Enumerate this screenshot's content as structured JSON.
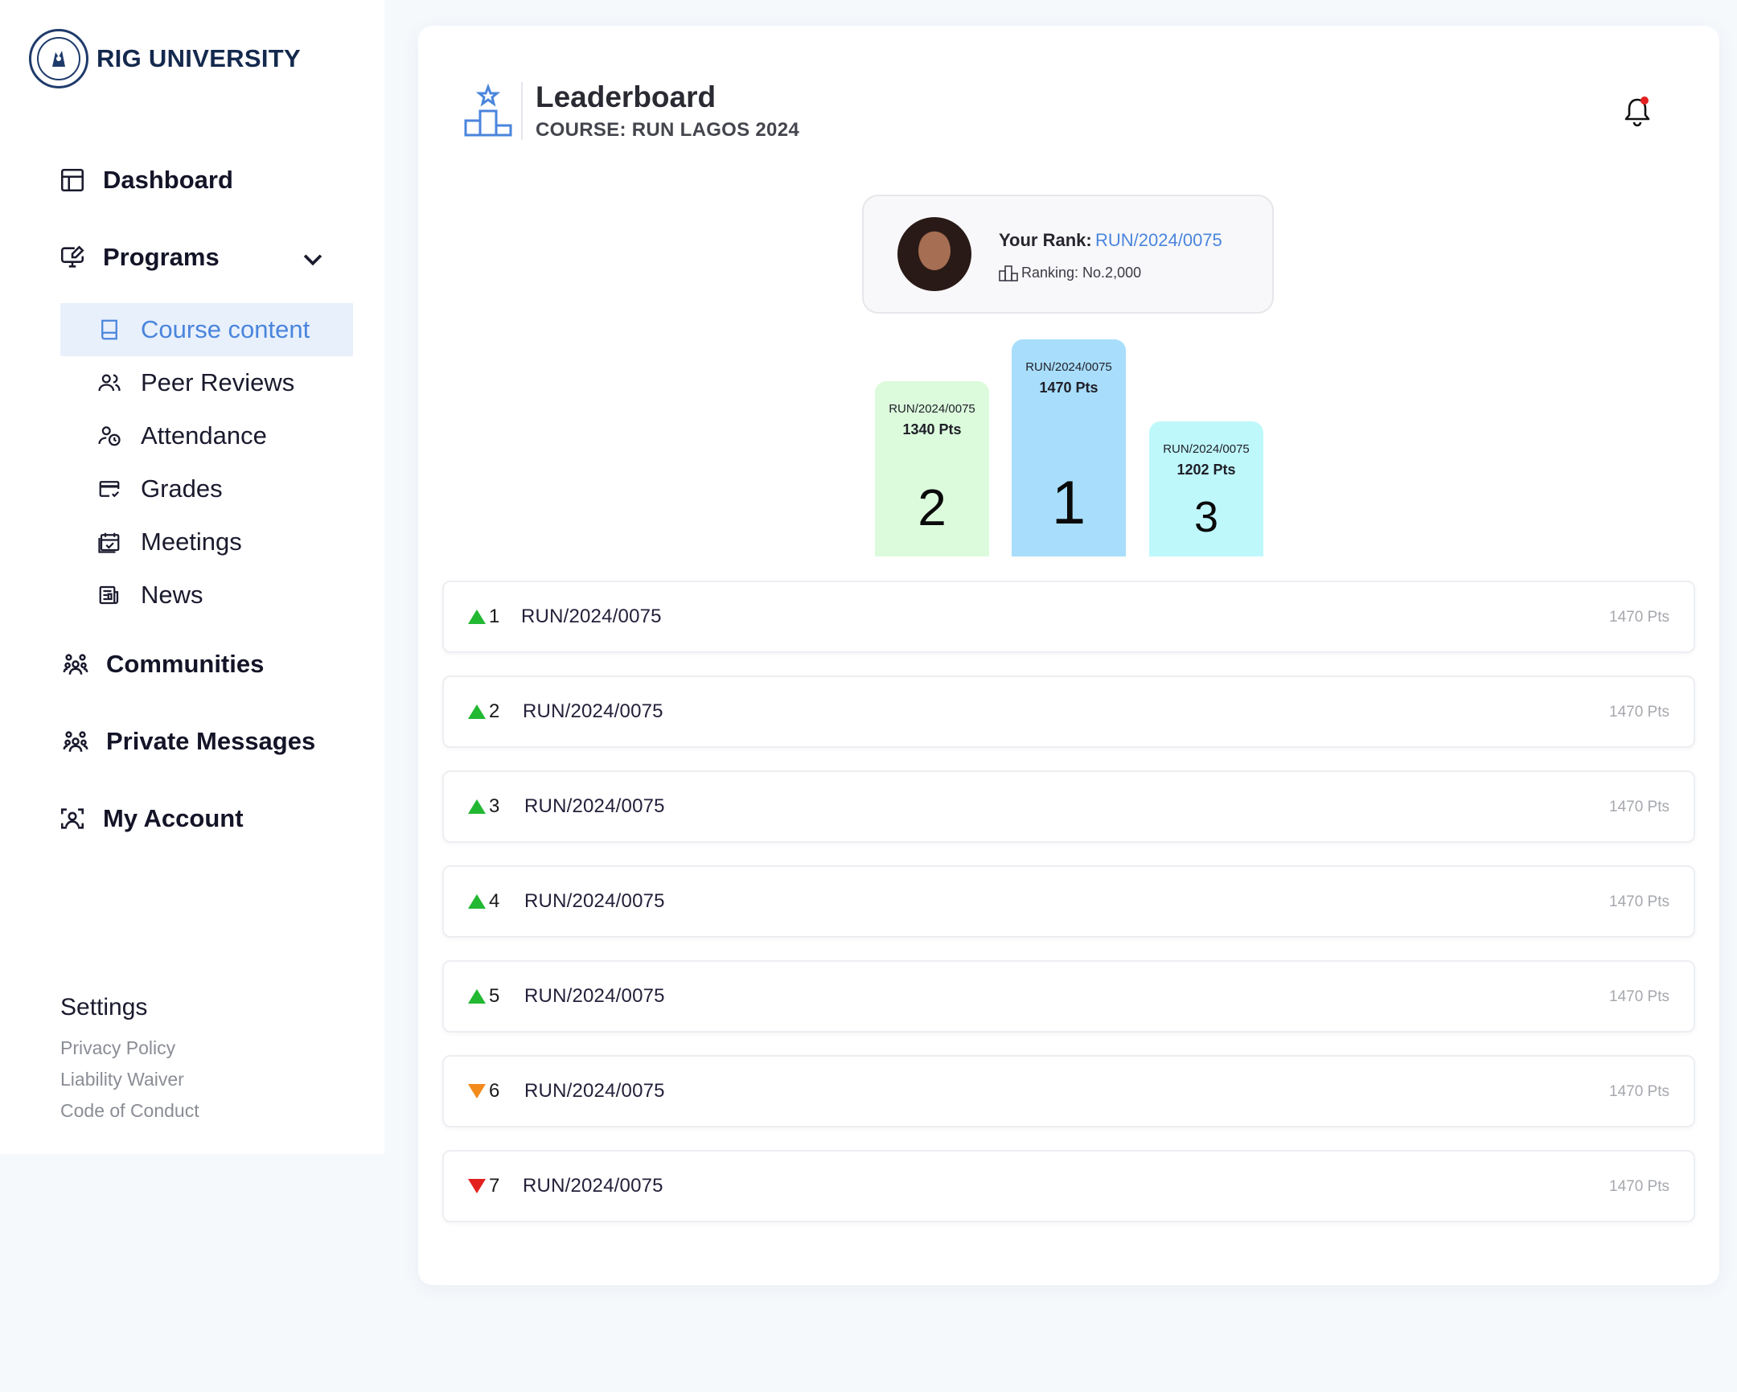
{
  "brand": {
    "name": "RIG UNIVERSITY"
  },
  "sidebar": {
    "dashboard": "Dashboard",
    "programs": "Programs",
    "sub_items": [
      {
        "label": "Course content",
        "icon": "book-icon",
        "active": true
      },
      {
        "label": "Peer Reviews",
        "icon": "users-icon"
      },
      {
        "label": "Attendance",
        "icon": "user-clock-icon"
      },
      {
        "label": "Grades",
        "icon": "card-check-icon"
      },
      {
        "label": "Meetings",
        "icon": "calendar-check-icon"
      },
      {
        "label": "News",
        "icon": "newspaper-icon"
      }
    ],
    "communities": "Communities",
    "private_messages": "Private Messages",
    "my_account": "My Account",
    "settings": {
      "title": "Settings",
      "links": [
        "Privacy Policy",
        "Liability Waiver",
        "Code of Conduct"
      ]
    }
  },
  "header": {
    "title": "Leaderboard",
    "subtitle": "COURSE: RUN LAGOS 2024"
  },
  "your_rank": {
    "label": "Your Rank:",
    "value": "RUN/2024/0075",
    "ranking": "Ranking: No.2,000"
  },
  "podium": [
    {
      "id": "RUN/2024/0075",
      "points": "1340 Pts",
      "rank": "2",
      "color": "#dcfbdc"
    },
    {
      "id": "RUN/2024/0075",
      "points": "1470 Pts",
      "rank": "1",
      "color": "#a8defb"
    },
    {
      "id": "RUN/2024/0075",
      "points": "1202 Pts",
      "rank": "3",
      "color": "#bff8fb"
    }
  ],
  "leaderboard": [
    {
      "position": "1",
      "id": "RUN/2024/0075",
      "points": "1470 Pts",
      "trend": "up"
    },
    {
      "position": "2",
      "id": "RUN/2024/0075",
      "points": "1470 Pts",
      "trend": "up"
    },
    {
      "position": "3",
      "id": "RUN/2024/0075",
      "points": "1470 Pts",
      "trend": "up"
    },
    {
      "position": "4",
      "id": "RUN/2024/0075",
      "points": "1470 Pts",
      "trend": "up"
    },
    {
      "position": "5",
      "id": "RUN/2024/0075",
      "points": "1470 Pts",
      "trend": "up"
    },
    {
      "position": "6",
      "id": "RUN/2024/0075",
      "points": "1470 Pts",
      "trend": "down-orange"
    },
    {
      "position": "7",
      "id": "RUN/2024/0075",
      "points": "1470 Pts",
      "trend": "down-red"
    }
  ],
  "colors": {
    "accent": "#4a85dc",
    "trend_up": "#22b832",
    "trend_down_orange": "#f28a1c",
    "trend_down_red": "#e3201f",
    "notification_dot": "#e3201f"
  }
}
